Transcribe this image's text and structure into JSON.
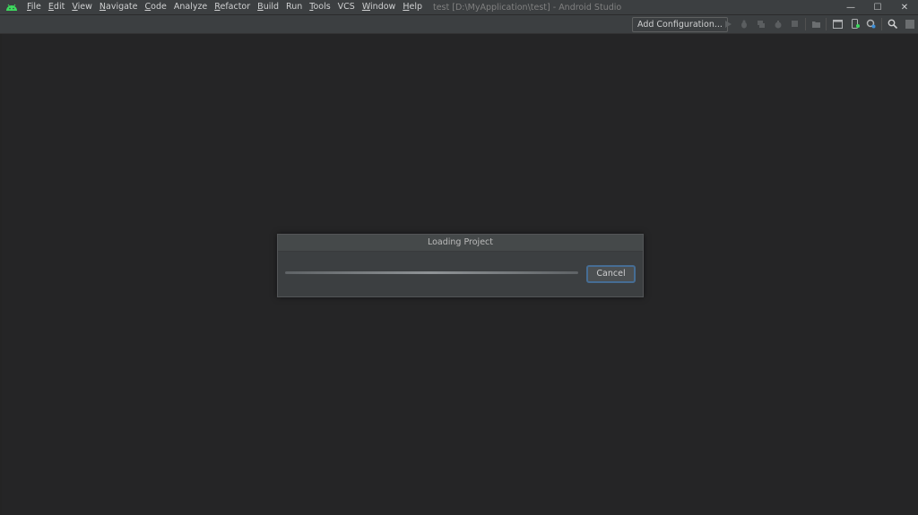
{
  "menu": {
    "items": [
      {
        "label": "File",
        "mnemonic": "F",
        "rest": "ile"
      },
      {
        "label": "Edit",
        "mnemonic": "E",
        "rest": "dit"
      },
      {
        "label": "View",
        "mnemonic": "V",
        "rest": "iew"
      },
      {
        "label": "Navigate",
        "mnemonic": "N",
        "rest": "avigate"
      },
      {
        "label": "Code",
        "mnemonic": "C",
        "rest": "ode"
      },
      {
        "label": "Analyze",
        "mnemonic": "",
        "rest": "Analyze"
      },
      {
        "label": "Refactor",
        "mnemonic": "R",
        "rest": "efactor"
      },
      {
        "label": "Build",
        "mnemonic": "B",
        "rest": "uild"
      },
      {
        "label": "Run",
        "mnemonic": "",
        "rest": "Run"
      },
      {
        "label": "Tools",
        "mnemonic": "T",
        "rest": "ools"
      },
      {
        "label": "VCS",
        "mnemonic": "",
        "rest": "VCS"
      },
      {
        "label": "Window",
        "mnemonic": "W",
        "rest": "indow"
      },
      {
        "label": "Help",
        "mnemonic": "H",
        "rest": "elp"
      }
    ]
  },
  "window": {
    "title": "test [D:\\MyApplication\\test] - Android Studio",
    "controls": {
      "minimize": "—",
      "maximize": "☐",
      "close": "✕"
    }
  },
  "toolbar": {
    "add_configuration_label": "Add Configuration...",
    "icons": [
      "run-icon",
      "debug-icon",
      "coverage-icon",
      "profile-icon",
      "stop-icon",
      "sync-icon",
      "device-manager-icon",
      "avd-icon",
      "sdk-manager-icon",
      "search-icon",
      "layout-icon"
    ]
  },
  "dialog": {
    "title": "Loading Project",
    "cancel_label": "Cancel",
    "progress": "indeterminate"
  },
  "colors": {
    "accent": "#3dd95e",
    "focus_border": "#466d94",
    "background": "#252526",
    "bar": "#3c3f41"
  }
}
